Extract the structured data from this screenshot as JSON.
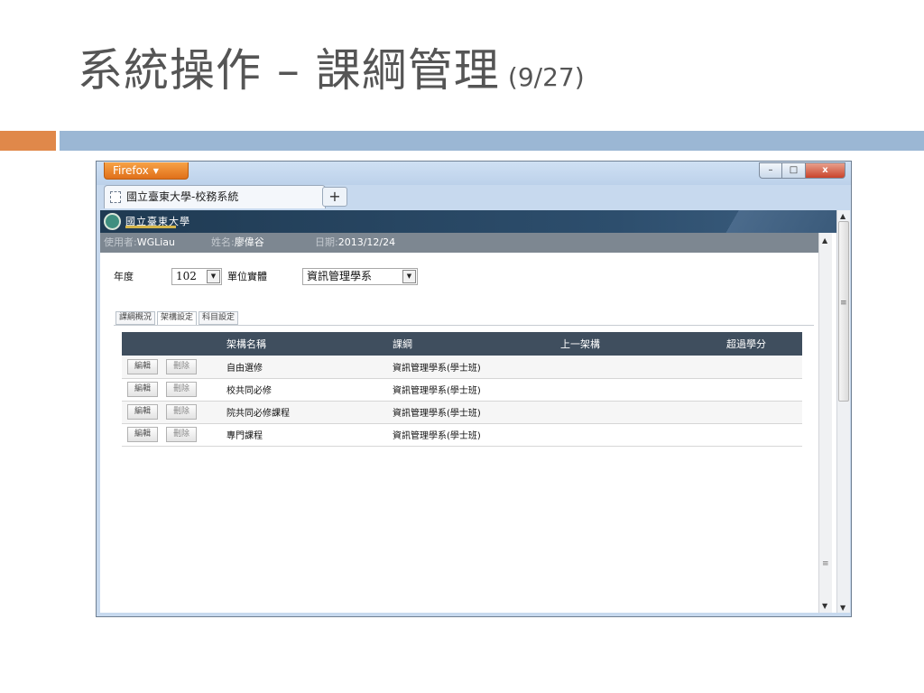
{
  "slide": {
    "title": "系統操作 – 課綱管理",
    "page": "(9/27)"
  },
  "browser": {
    "menu_button": "Firefox",
    "tab_title": "國立臺東大學-校務系統",
    "new_tab": "+",
    "window_buttons": {
      "minimize": "–",
      "maximize": "□",
      "close": "x"
    }
  },
  "site": {
    "logo_text": "國立臺東大學",
    "user": {
      "user_label": "使用者:",
      "user_value": "WGLiau",
      "name_label": "姓名:",
      "name_value": "廖偉谷",
      "date_label": "日期:",
      "date_value": "2013/12/24"
    },
    "filters": {
      "year_label": "年度",
      "year_value": "102",
      "unit_label": "單位實體",
      "unit_value": "資訊管理學系"
    },
    "tabs": [
      "課綱概況",
      "架構設定",
      "科目設定"
    ],
    "table": {
      "headers": [
        "",
        "架構名稱",
        "課綱",
        "上一架構",
        "超過學分"
      ],
      "edit_label": "編輯",
      "delete_label": "刪除",
      "rows": [
        {
          "name": "自由選修",
          "program": "資訊管理學系(學士班)",
          "parent": "",
          "credits": ""
        },
        {
          "name": "校共同必修",
          "program": "資訊管理學系(學士班)",
          "parent": "",
          "credits": ""
        },
        {
          "name": "院共同必修課程",
          "program": "資訊管理學系(學士班)",
          "parent": "",
          "credits": ""
        },
        {
          "name": "專門課程",
          "program": "資訊管理學系(學士班)",
          "parent": "",
          "credits": ""
        }
      ]
    }
  },
  "colors": {
    "accent_orange": "#e0884a",
    "accent_blue": "#9bb7d4",
    "header_dark": "#1f3a52",
    "table_header": "#3f4e5e"
  }
}
